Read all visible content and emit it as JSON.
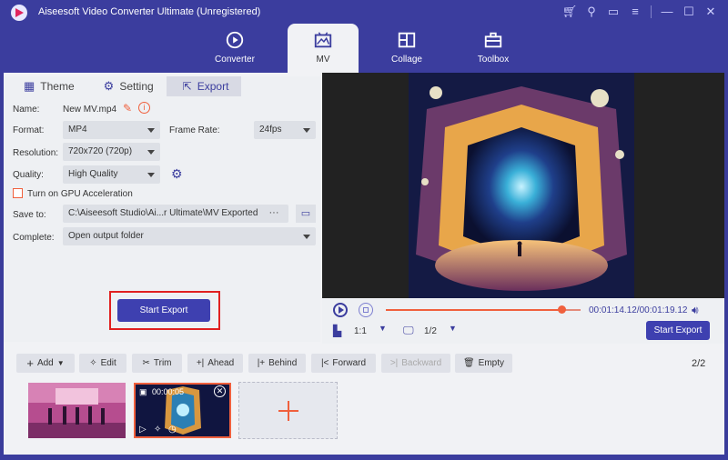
{
  "app": {
    "title": "Aiseesoft Video Converter Ultimate (Unregistered)",
    "accent": "#3b3d9e",
    "highlight": "#f0603d"
  },
  "window_controls": [
    "cart-icon",
    "key-icon",
    "feedback-icon",
    "menu-icon",
    "minimize-icon",
    "maximize-icon",
    "close-icon"
  ],
  "nav": {
    "tabs": [
      {
        "label": "Converter",
        "icon": "converter-icon",
        "active": false
      },
      {
        "label": "MV",
        "icon": "mv-icon",
        "active": true
      },
      {
        "label": "Collage",
        "icon": "collage-icon",
        "active": false
      },
      {
        "label": "Toolbox",
        "icon": "toolbox-icon",
        "active": false
      }
    ]
  },
  "subtabs": [
    {
      "label": "Theme",
      "icon": "theme-icon"
    },
    {
      "label": "Setting",
      "icon": "gear-icon"
    },
    {
      "label": "Export",
      "icon": "export-icon",
      "active": true
    }
  ],
  "export_form": {
    "name_label": "Name:",
    "name_value": "New MV.mp4",
    "format_label": "Format:",
    "format_value": "MP4",
    "frame_rate_label": "Frame Rate:",
    "frame_rate_value": "24fps",
    "resolution_label": "Resolution:",
    "resolution_value": "720x720 (720p)",
    "quality_label": "Quality:",
    "quality_value": "High Quality",
    "gpu_label": "Turn on GPU Acceleration",
    "gpu_checked": false,
    "save_to_label": "Save to:",
    "save_to_value": "C:\\Aiseesoft Studio\\Ai...r Ultimate\\MV Exported",
    "browse_label": "···",
    "complete_label": "Complete:",
    "complete_value": "Open output folder",
    "start_export_label": "Start Export"
  },
  "player": {
    "progress": 0.9,
    "time_current": "00:01:14.12",
    "time_total": "00:01:19.12",
    "ratio_label": "1:1",
    "page_label": "1/2",
    "start_export_label": "Start Export"
  },
  "toolbar": {
    "add": "Add",
    "edit": "Edit",
    "trim": "Trim",
    "ahead": "Ahead",
    "behind": "Behind",
    "forward": "Forward",
    "backward": "Backward",
    "empty": "Empty",
    "page_count": "2/2"
  },
  "clips": [
    {
      "duration": ""
    },
    {
      "duration": "00:00:05"
    }
  ]
}
